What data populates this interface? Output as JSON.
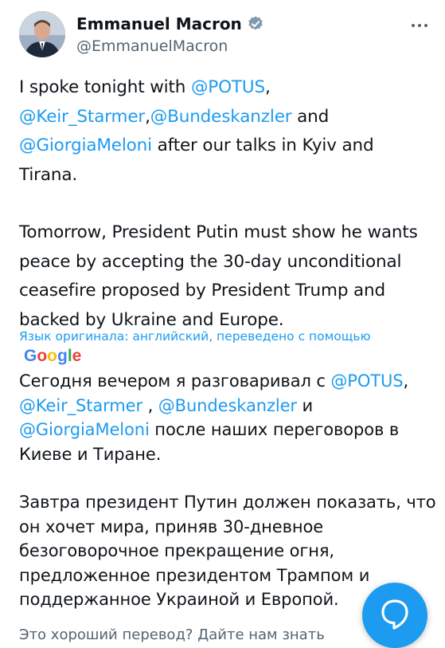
{
  "author": {
    "name": "Emmanuel Macron",
    "handle": "@EmmanuelMacron",
    "verified_color": "#829aab"
  },
  "tweet": {
    "paragraph1": [
      {
        "text": "I spoke tonight with ",
        "type": "text"
      },
      {
        "text": "@POTUS",
        "type": "mention"
      },
      {
        "text": ", ",
        "type": "text"
      },
      {
        "text": "@Keir_Starmer",
        "type": "mention"
      },
      {
        "text": ",",
        "type": "text"
      },
      {
        "text": "@Bundeskanzler",
        "type": "mention"
      },
      {
        "text": " and ",
        "type": "text"
      },
      {
        "text": "@GiorgiaMeloni",
        "type": "mention"
      },
      {
        "text": " after our talks in Kyiv and Tirana.",
        "type": "text"
      }
    ],
    "paragraph2": "Tomorrow, President Putin must show he wants peace by accepting the 30-day unconditional ceasefire proposed by President Trump and backed by Ukraine and Europe."
  },
  "translation": {
    "note": "Язык оригинала: английский, переведено с помощью",
    "provider": "Google",
    "paragraph1": [
      {
        "text": "Сегодня вечером я разговаривал с ",
        "type": "text"
      },
      {
        "text": "@POTUS",
        "type": "mention"
      },
      {
        "text": ", ",
        "type": "text"
      },
      {
        "text": "@Keir_Starmer",
        "type": "mention"
      },
      {
        "text": " , ",
        "type": "text"
      },
      {
        "text": "@Bundeskanzler",
        "type": "mention"
      },
      {
        "text": " и ",
        "type": "text"
      },
      {
        "text": "@GiorgiaMeloni",
        "type": "mention"
      },
      {
        "text": " после наших переговоров в Киеве и Тиране.",
        "type": "text"
      }
    ],
    "paragraph2": "Завтра президент Путин должен показать, что он хочет мира, приняв 30-дневное безоговорочное прекращение огня, предложенное президентом Трампом и поддержанное Украиной и Европой.",
    "feedback_cut": "Это хороший перевод? Дайте нам знать"
  },
  "fab": {
    "icon": "chat-bubble-icon",
    "color": "#1d9bf0"
  },
  "colors": {
    "link": "#1d9bf0",
    "text": "#0f1419",
    "secondary": "#536471"
  }
}
